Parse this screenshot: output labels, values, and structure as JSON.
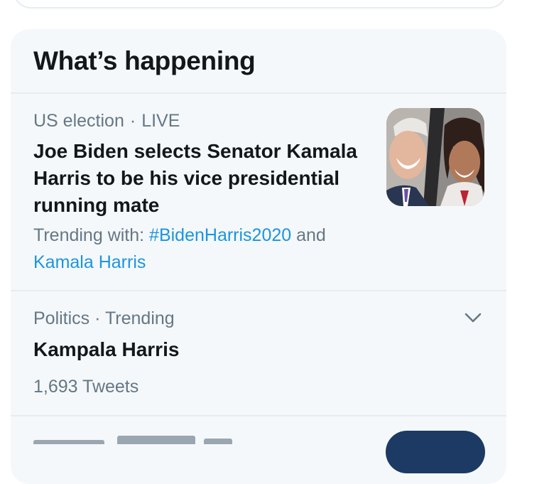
{
  "whats_happening": {
    "title": "What’s happening",
    "trends": [
      {
        "category": "US election",
        "separator": "·",
        "status": "LIVE",
        "headline": "Joe Biden selects Senator Kamala Harris to be his vice presidential running mate",
        "context_prefix": "Trending with:",
        "hashtag": "#BidenHarris2020",
        "conjunction": "and",
        "related": "Kamala Harris",
        "thumbnail_icon": "news-photo-thumbnail"
      },
      {
        "meta": "Politics · Trending",
        "name": "Kampala Harris",
        "tweet_count": "1,693 Tweets",
        "menu_icon": "chevron-down-icon"
      }
    ]
  },
  "colors": {
    "panel_bg": "#f5f8fa",
    "divider": "#e6ecf0",
    "primary_text": "#14171a",
    "secondary_text": "#657786",
    "link": "#1b95e0"
  }
}
